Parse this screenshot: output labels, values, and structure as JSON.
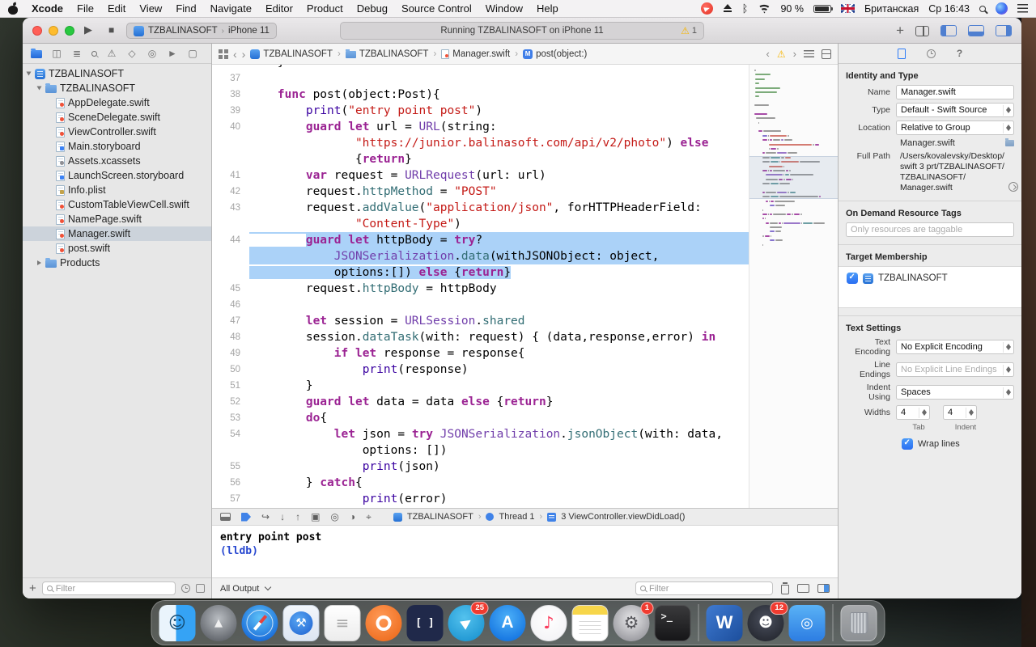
{
  "menu_bar": {
    "items": [
      "Xcode",
      "File",
      "Edit",
      "View",
      "Find",
      "Navigate",
      "Editor",
      "Product",
      "Debug",
      "Source Control",
      "Window",
      "Help"
    ],
    "status": {
      "battery_pct": "90 %",
      "input_lang": "Британская",
      "clock": "Ср 16:43"
    }
  },
  "toolbar": {
    "scheme": "TZBALINASOFT",
    "device": "iPhone 11",
    "status_text": "Running TZBALINASOFT on iPhone 11",
    "warning_count": "1"
  },
  "navigator": {
    "files": [
      {
        "label": "TZBALINASOFT",
        "type": "project",
        "level": 0,
        "disc": "open"
      },
      {
        "label": "TZBALINASOFT",
        "type": "folder",
        "level": 1,
        "disc": "open"
      },
      {
        "label": "AppDelegate.swift",
        "type": "swift",
        "level": 2
      },
      {
        "label": "SceneDelegate.swift",
        "type": "swift",
        "level": 2
      },
      {
        "label": "ViewController.swift",
        "type": "swift",
        "level": 2
      },
      {
        "label": "Main.storyboard",
        "type": "storyboard",
        "level": 2
      },
      {
        "label": "Assets.xcassets",
        "type": "assets",
        "level": 2
      },
      {
        "label": "LaunchScreen.storyboard",
        "type": "storyboard",
        "level": 2
      },
      {
        "label": "Info.plist",
        "type": "plist",
        "level": 2
      },
      {
        "label": "CustomTableViewCell.swift",
        "type": "swift",
        "level": 2
      },
      {
        "label": "NamePage.swift",
        "type": "swift",
        "level": 2
      },
      {
        "label": "Manager.swift",
        "type": "swift",
        "level": 2,
        "selected": true
      },
      {
        "label": "post.swift",
        "type": "swift",
        "level": 2
      },
      {
        "label": "Products",
        "type": "folder",
        "level": 1,
        "disc": "closed"
      }
    ],
    "filter_placeholder": "Filter"
  },
  "jump_bar": {
    "crumbs": [
      {
        "label": "TZBALINASOFT",
        "icon": "app"
      },
      {
        "label": "TZBALINASOFT",
        "icon": "folder"
      },
      {
        "label": "Manager.swift",
        "icon": "swift"
      },
      {
        "label": "post(object:)",
        "icon": "method"
      }
    ]
  },
  "editor": {
    "lines": [
      {
        "n": "36",
        "ind": 4,
        "parts": [
          [
            "}",
            "p"
          ]
        ]
      },
      {
        "n": "37",
        "ind": 0,
        "parts": []
      },
      {
        "n": "38",
        "ind": 4,
        "parts": [
          [
            "func",
            "k"
          ],
          [
            " post(object:Post){",
            "p"
          ]
        ]
      },
      {
        "n": "39",
        "ind": 8,
        "parts": [
          [
            "print",
            "f"
          ],
          [
            "(",
            "p"
          ],
          [
            "\"entry point post\"",
            "s"
          ],
          [
            ")",
            "p"
          ]
        ]
      },
      {
        "n": "40",
        "ind": 8,
        "parts": [
          [
            "guard",
            "k"
          ],
          [
            " ",
            "p"
          ],
          [
            "let",
            "k"
          ],
          [
            " url = ",
            "p"
          ],
          [
            "URL",
            "t"
          ],
          [
            "(string:",
            "p"
          ]
        ]
      },
      {
        "ind": 15,
        "parts": [
          [
            "\"https://junior.balinasoft.com/api/v2/photo\"",
            "s"
          ],
          [
            ") ",
            "p"
          ],
          [
            "else",
            "k"
          ]
        ]
      },
      {
        "ind": 15,
        "parts": [
          [
            "{",
            "p"
          ],
          [
            "return",
            "k"
          ],
          [
            "}",
            "p"
          ]
        ]
      },
      {
        "n": "41",
        "ind": 8,
        "parts": [
          [
            "var",
            "k"
          ],
          [
            " request = ",
            "p"
          ],
          [
            "URLRequest",
            "t"
          ],
          [
            "(url: url)",
            "p"
          ]
        ]
      },
      {
        "n": "42",
        "ind": 8,
        "parts": [
          [
            "request.",
            "p"
          ],
          [
            "httpMethod",
            "m"
          ],
          [
            " = ",
            "p"
          ],
          [
            "\"POST\"",
            "s"
          ]
        ]
      },
      {
        "n": "43",
        "ind": 8,
        "parts": [
          [
            "request.",
            "p"
          ],
          [
            "addValue",
            "m"
          ],
          [
            "(",
            "p"
          ],
          [
            "\"application/json\"",
            "s"
          ],
          [
            ", forHTTPHeaderField:",
            "p"
          ]
        ]
      },
      {
        "ind": 15,
        "parts": [
          [
            "\"Content-Type\"",
            "s"
          ],
          [
            ")",
            "p"
          ]
        ]
      },
      {
        "n": "44",
        "ind": 8,
        "sel": "text-ext",
        "parts": [
          [
            "guard",
            "k"
          ],
          [
            " ",
            "p"
          ],
          [
            "let",
            "k"
          ],
          [
            " httpBody = ",
            "p"
          ],
          [
            "try",
            "k"
          ],
          [
            "?",
            "p"
          ]
        ]
      },
      {
        "ind": 12,
        "sel": "line-ext",
        "parts": [
          [
            "JSONSerialization",
            "t"
          ],
          [
            ".",
            "p"
          ],
          [
            "data",
            "m"
          ],
          [
            "(withJSONObject: object,",
            "p"
          ]
        ]
      },
      {
        "ind": 12,
        "sel": "line-end",
        "parts": [
          [
            "options:[]) ",
            "p"
          ],
          [
            "else",
            "k"
          ],
          [
            " {",
            "p"
          ],
          [
            "return",
            "k"
          ],
          [
            "}",
            "p"
          ]
        ]
      },
      {
        "n": "45",
        "ind": 8,
        "parts": [
          [
            "request.",
            "p"
          ],
          [
            "httpBody",
            "m"
          ],
          [
            " = httpBody",
            "p"
          ]
        ]
      },
      {
        "n": "46",
        "ind": 0,
        "parts": []
      },
      {
        "n": "47",
        "ind": 8,
        "parts": [
          [
            "let",
            "k"
          ],
          [
            " session = ",
            "p"
          ],
          [
            "URLSession",
            "t"
          ],
          [
            ".",
            "p"
          ],
          [
            "shared",
            "m"
          ]
        ]
      },
      {
        "n": "48",
        "ind": 8,
        "parts": [
          [
            "session.",
            "p"
          ],
          [
            "dataTask",
            "m"
          ],
          [
            "(with: request) { (data,response,error) ",
            "p"
          ],
          [
            "in",
            "k"
          ]
        ]
      },
      {
        "n": "49",
        "ind": 12,
        "parts": [
          [
            "if",
            "k"
          ],
          [
            " ",
            "p"
          ],
          [
            "let",
            "k"
          ],
          [
            " response = response{",
            "p"
          ]
        ]
      },
      {
        "n": "50",
        "ind": 16,
        "parts": [
          [
            "print",
            "f"
          ],
          [
            "(response)",
            "p"
          ]
        ]
      },
      {
        "n": "51",
        "ind": 8,
        "parts": [
          [
            "}",
            "p"
          ]
        ]
      },
      {
        "n": "52",
        "ind": 8,
        "parts": [
          [
            "guard",
            "k"
          ],
          [
            " ",
            "p"
          ],
          [
            "let",
            "k"
          ],
          [
            " data = data ",
            "p"
          ],
          [
            "else",
            "k"
          ],
          [
            " {",
            "p"
          ],
          [
            "return",
            "k"
          ],
          [
            "}",
            "p"
          ]
        ]
      },
      {
        "n": "53",
        "ind": 8,
        "parts": [
          [
            "do",
            "k"
          ],
          [
            "{",
            "p"
          ]
        ]
      },
      {
        "n": "54",
        "ind": 12,
        "parts": [
          [
            "let",
            "k"
          ],
          [
            " json = ",
            "p"
          ],
          [
            "try",
            "k"
          ],
          [
            " ",
            "p"
          ],
          [
            "JSONSerialization",
            "t"
          ],
          [
            ".",
            "p"
          ],
          [
            "jsonObject",
            "m"
          ],
          [
            "(with: data,",
            "p"
          ]
        ]
      },
      {
        "ind": 16,
        "parts": [
          [
            "options: [])",
            "p"
          ]
        ]
      },
      {
        "n": "55",
        "ind": 16,
        "parts": [
          [
            "print",
            "f"
          ],
          [
            "(json)",
            "p"
          ]
        ]
      },
      {
        "n": "56",
        "ind": 8,
        "parts": [
          [
            "} ",
            "p"
          ],
          [
            "catch",
            "k"
          ],
          [
            "{",
            "p"
          ]
        ]
      },
      {
        "n": "57",
        "ind": 16,
        "parts": [
          [
            "print",
            "f"
          ],
          [
            "(error)",
            "p"
          ]
        ]
      },
      {
        "n": "58",
        "ind": 8,
        "parts": [
          [
            "}",
            "p"
          ]
        ]
      }
    ]
  },
  "minimap": {
    "header": [
      [
        0,
        2,
        "p"
      ],
      [
        1,
        16,
        "c"
      ],
      [
        1,
        10,
        "c"
      ],
      [
        1,
        4,
        "c"
      ],
      [
        1,
        26,
        "c"
      ],
      [
        1,
        22,
        "c"
      ],
      [
        1,
        4,
        "c"
      ],
      [
        0,
        0,
        "p"
      ],
      [
        0,
        15,
        "p"
      ],
      [
        0,
        0,
        "p"
      ],
      [
        0,
        13,
        "k"
      ],
      [
        2,
        20,
        "p"
      ]
    ]
  },
  "inspector": {
    "identity_header": "Identity and Type",
    "name_label": "Name",
    "name_value": "Manager.swift",
    "type_label": "Type",
    "type_value": "Default - Swift Source",
    "location_label": "Location",
    "location_value": "Relative to Group",
    "location_file": "Manager.swift",
    "fullpath_label": "Full Path",
    "fullpath_value": "/Users/kovalevsky/Desktop/\nswift 3 prt/TZBALINASOFT/\nTZBALINASOFT/\nManager.swift",
    "odr_header": "On Demand Resource Tags",
    "odr_placeholder": "Only resources are taggable",
    "target_header": "Target Membership",
    "target_item": "TZBALINASOFT",
    "text_header": "Text Settings",
    "encoding_label": "Text Encoding",
    "encoding_value": "No Explicit Encoding",
    "lineendings_label": "Line Endings",
    "lineendings_value": "No Explicit Line Endings",
    "indent_label": "Indent Using",
    "indent_value": "Spaces",
    "widths_label": "Widths",
    "tab_width": "4",
    "indent_width": "4",
    "tab_sub": "Tab",
    "indent_sub": "Indent",
    "wrap_label": "Wrap lines"
  },
  "debug": {
    "crumb_app": "TZBALINASOFT",
    "crumb_thread": "Thread 1",
    "crumb_frame": "3 ViewController.viewDidLoad()",
    "console_line1": "entry point post",
    "console_line2": "(lldb)",
    "all_output": "All Output",
    "filter_placeholder": "Filter"
  },
  "dock": {
    "apps": [
      {
        "name": "finder"
      },
      {
        "name": "launchpad"
      },
      {
        "name": "safari"
      },
      {
        "name": "xcode"
      },
      {
        "name": "textedit"
      },
      {
        "name": "postman"
      },
      {
        "name": "brackets"
      },
      {
        "name": "telegram",
        "badge": "25"
      },
      {
        "name": "app-store"
      },
      {
        "name": "music"
      },
      {
        "name": "notes"
      },
      {
        "name": "system-preferences",
        "badge": "1"
      },
      {
        "name": "terminal"
      },
      {
        "name": "separator"
      },
      {
        "name": "word"
      },
      {
        "name": "discord",
        "badge": "12"
      },
      {
        "name": "appcode"
      },
      {
        "name": "separator"
      },
      {
        "name": "trash"
      }
    ]
  },
  "colors": {
    "accent": "#3478f6",
    "selection": "#abd2f8",
    "keyword": "#9b2393",
    "string": "#c41a16",
    "warning": "#f7b500"
  }
}
